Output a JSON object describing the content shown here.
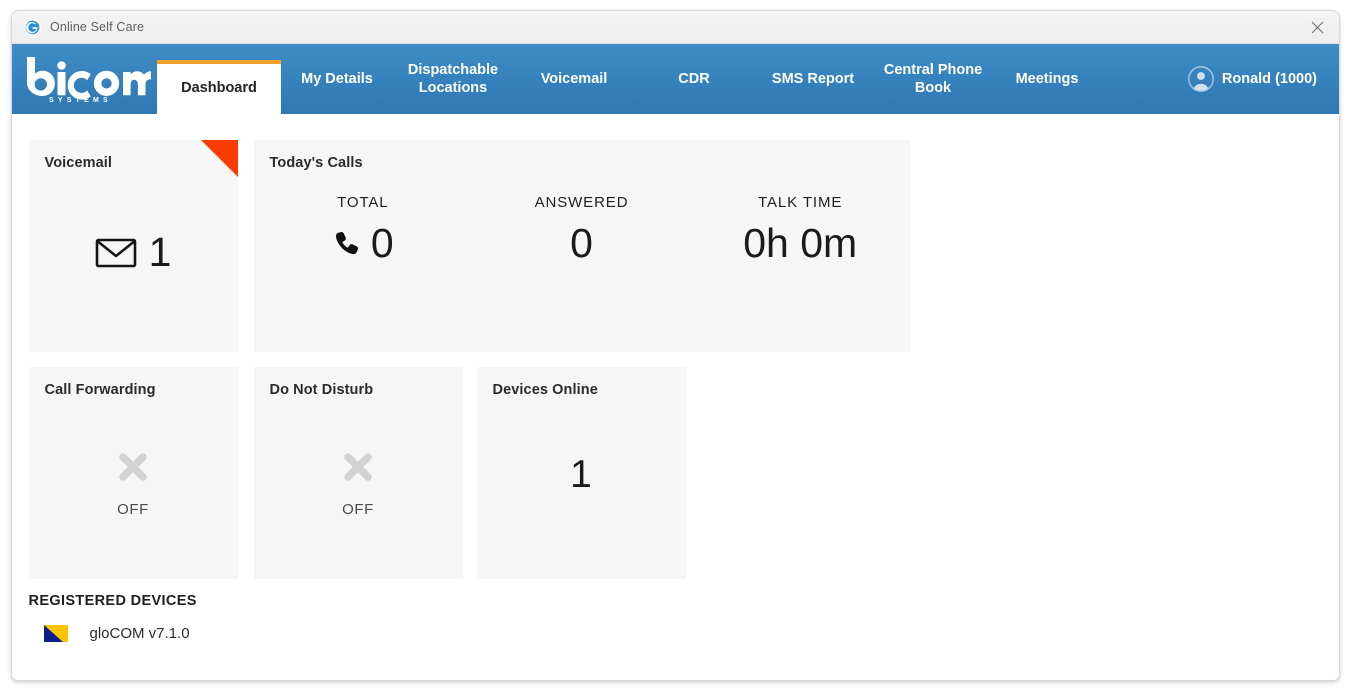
{
  "window": {
    "title": "Online Self Care",
    "favicon_name": "bicom-globe-icon",
    "close_label": "×"
  },
  "header": {
    "logo_text": "bicom",
    "logo_subtext": "S Y S T E M S",
    "user": {
      "name": "Ronald (1000)",
      "avatar_icon": "user-circle-icon"
    },
    "tabs": [
      {
        "label": "Dashboard",
        "active": true
      },
      {
        "label": "My Details",
        "active": false
      },
      {
        "label": "Dispatchable Locations",
        "active": false
      },
      {
        "label": "Voicemail",
        "active": false
      },
      {
        "label": "CDR",
        "active": false
      },
      {
        "label": "SMS Report",
        "active": false
      },
      {
        "label": "Central Phone Book",
        "active": false
      },
      {
        "label": "Meetings",
        "active": false
      }
    ]
  },
  "dashboard": {
    "voicemail_card": {
      "title": "Voicemail",
      "count": "1",
      "icon": "envelope-icon",
      "flag_color": "#f83c00"
    },
    "calls_card": {
      "title": "Today's Calls",
      "stats": [
        {
          "label": "TOTAL",
          "value": "0",
          "icon": "phone-icon"
        },
        {
          "label": "ANSWERED",
          "value": "0",
          "icon": ""
        },
        {
          "label": "TALK TIME",
          "value": "0h 0m",
          "icon": ""
        }
      ]
    },
    "call_forwarding_card": {
      "title": "Call Forwarding",
      "state": "OFF",
      "icon": "x-mark-icon"
    },
    "dnd_card": {
      "title": "Do Not Disturb",
      "state": "OFF",
      "icon": "x-mark-icon"
    },
    "devices_online_card": {
      "title": "Devices Online",
      "count": "1"
    },
    "registered_devices": {
      "heading": "REGISTERED DEVICES",
      "items": [
        {
          "name": "gloCOM v7.1.0",
          "icon": "glocom-flag-icon"
        }
      ]
    }
  },
  "colors": {
    "header_blue": "#3783be",
    "accent_orange": "#f0a32a",
    "flag_orange": "#f83c00",
    "card_bg": "#f6f6f6"
  }
}
